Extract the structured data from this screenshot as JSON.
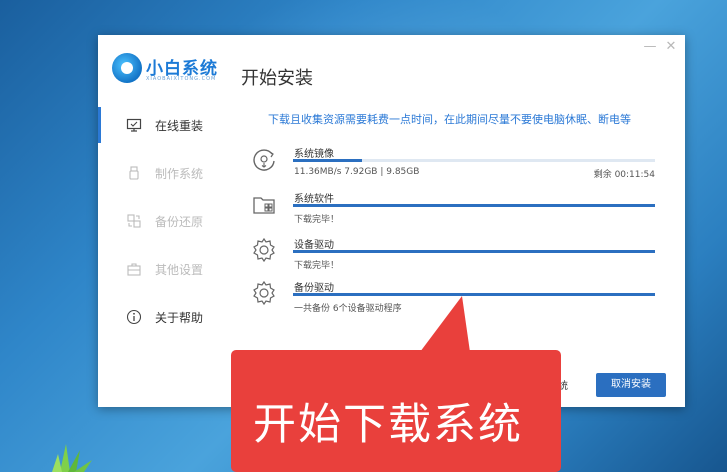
{
  "logo": {
    "title": "小白系统",
    "subtitle": "XIAOBAIXITONG.COM"
  },
  "page_title": "开始安装",
  "window_controls": {
    "minimize_glyph": "—",
    "close_glyph": "✕"
  },
  "sidebar": {
    "items": [
      {
        "label": "在线重装",
        "icon": "monitor-icon",
        "state": "active"
      },
      {
        "label": "制作系统",
        "icon": "usb-icon",
        "state": "inactive"
      },
      {
        "label": "备份还原",
        "icon": "backup-icon",
        "state": "inactive"
      },
      {
        "label": "其他设置",
        "icon": "toolbox-icon",
        "state": "inactive"
      },
      {
        "label": "关于帮助",
        "icon": "info-icon",
        "state": "normal"
      }
    ]
  },
  "notice": "下载且收集资源需要耗费一点时间，在此期间尽量不要使电脑休眠、断电等",
  "downloads": [
    {
      "name": "系统镜像",
      "icon": "disc-download-icon",
      "progress": 0.19,
      "status": "11.36MB/s 7.92GB | 9.85GB",
      "remaining": "剩余 00:11:54"
    },
    {
      "name": "系统软件",
      "icon": "folder-apps-icon",
      "progress": 1.0,
      "status": "下载完毕！"
    },
    {
      "name": "设备驱动",
      "icon": "gear-icon",
      "progress": 1.0,
      "status": "下载完毕！"
    },
    {
      "name": "备份驱动",
      "icon": "gear-icon",
      "progress": 1.0,
      "status": "一共备份 6个设备驱动程序"
    }
  ],
  "buttons": {
    "backup_label": "系统",
    "cancel_label": "取消安装"
  },
  "callout": {
    "text": "开始下载系统",
    "color": "#e9403c"
  },
  "colors": {
    "accent": "#2b79d6",
    "progress": "#2b6fc0"
  }
}
